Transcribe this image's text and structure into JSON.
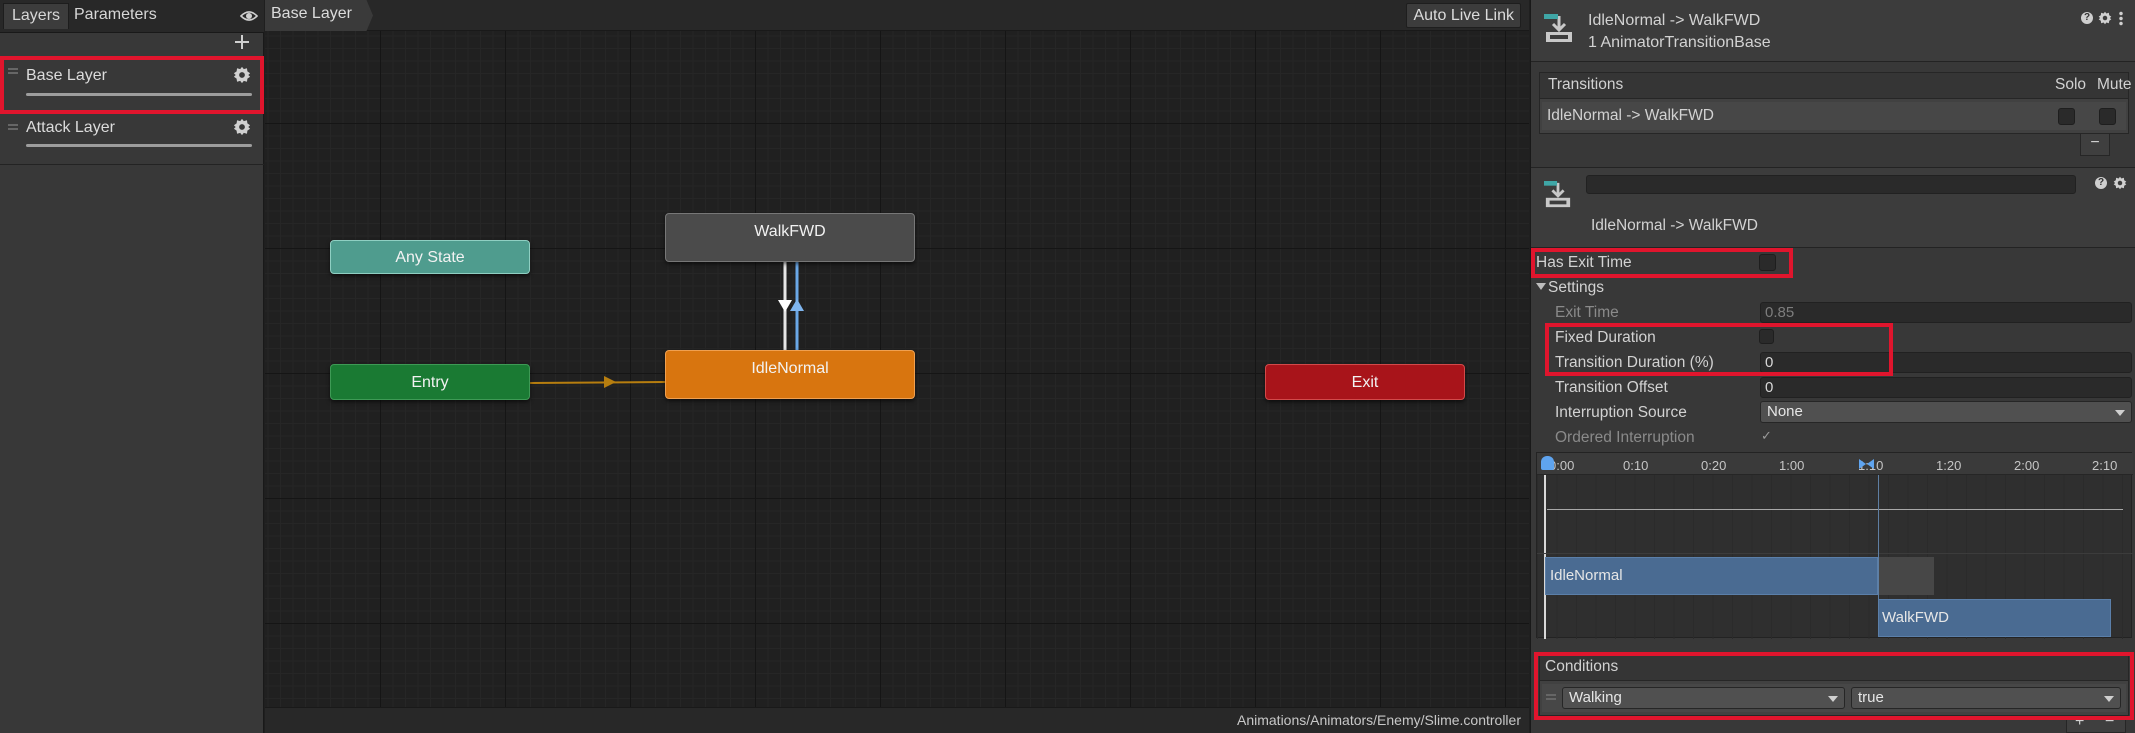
{
  "left_panel": {
    "tabs": [
      {
        "label": "Layers"
      },
      {
        "label": "Parameters"
      }
    ],
    "layers": [
      {
        "name": "Base Layer"
      },
      {
        "name": "Attack Layer"
      }
    ]
  },
  "graph": {
    "breadcrumb": "Base Layer",
    "auto_live_link": "Auto Live Link",
    "nodes": {
      "any_state": "Any State",
      "entry": "Entry",
      "walk_fwd": "WalkFWD",
      "idle_normal": "IdleNormal",
      "exit": "Exit"
    },
    "asset_path": "Animations/Animators/Enemy/Slime.controller",
    "colors": {
      "any_state": "#4f9c8e",
      "entry": "#1a7a33",
      "state": "#4b4b4b",
      "default_state": "#d8750f",
      "exit": "#a8141a"
    }
  },
  "inspector": {
    "title": "IdleNormal -> WalkFWD",
    "subtitle": "1 AnimatorTransitionBase",
    "transitions_header": "Transitions",
    "solo_label": "Solo",
    "mute_label": "Mute",
    "transition_row": "IdleNormal -> WalkFWD",
    "name_field_value": "",
    "transition_name": "IdleNormal -> WalkFWD",
    "has_exit_time": {
      "label": "Has Exit Time",
      "checked": false
    },
    "settings_label": "Settings",
    "exit_time": {
      "label": "Exit Time",
      "value": "0.85"
    },
    "fixed_duration": {
      "label": "Fixed Duration",
      "checked": false
    },
    "transition_duration": {
      "label": "Transition Duration (%)",
      "value": "0"
    },
    "transition_offset": {
      "label": "Transition Offset",
      "value": "0"
    },
    "interruption_source": {
      "label": "Interruption Source",
      "value": "None"
    },
    "ordered_interruption": {
      "label": "Ordered Interruption",
      "checked": true
    },
    "timeline": {
      "ticks": [
        "0:00",
        "0:10",
        "0:20",
        "1:00",
        "1:10",
        "1:20",
        "2:00",
        "2:10"
      ],
      "from_state": "IdleNormal",
      "to_state": "WalkFWD"
    },
    "conditions": {
      "header": "Conditions",
      "parameter": "Walking",
      "value": "true"
    }
  }
}
